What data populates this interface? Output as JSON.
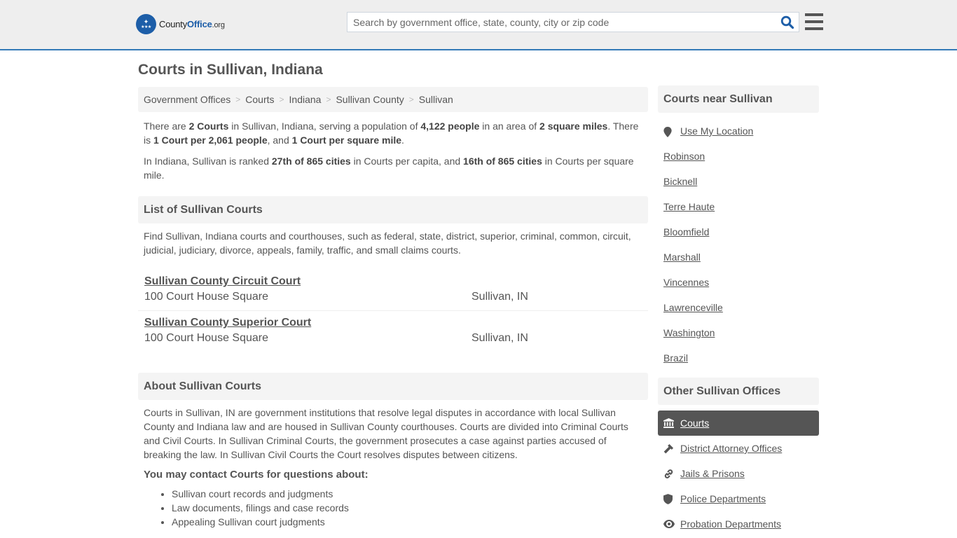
{
  "header": {
    "logo": {
      "prefix": "County",
      "brand": "Office",
      "suffix": ".org",
      "color": "#1d5ea8"
    },
    "search": {
      "placeholder": "Search by government office, state, county, city or zip code",
      "value": ""
    },
    "search_icon": "search-icon",
    "menu_icon": "hamburger-menu-icon",
    "accent": "#337ab7"
  },
  "page": {
    "title": "Courts in Sullivan, Indiana"
  },
  "breadcrumb": [
    "Government Offices",
    "Courts",
    "Indiana",
    "Sullivan County",
    "Sullivan"
  ],
  "summary": {
    "p1": {
      "t1": "There are ",
      "b1": "2 Courts",
      "t2": " in Sullivan, Indiana, serving a population of ",
      "b2": "4,122 people",
      "t3": " in an area of ",
      "b3": "2 square miles",
      "t4": ". There is ",
      "b4": "1 Court per 2,061 people",
      "t5": ", and ",
      "b5": "1 Court per square mile",
      "t6": "."
    },
    "p2": {
      "t1": "In Indiana, Sullivan is ranked ",
      "b1": "27th of 865 cities",
      "t2": " in Courts per capita, and ",
      "b2": "16th of 865 cities",
      "t3": " in Courts per square mile."
    }
  },
  "list_section": {
    "title": "List of Sullivan Courts",
    "description": "Find Sullivan, Indiana courts and courthouses, such as federal, state, district, superior, criminal, common, circuit, judicial, judiciary, divorce, appeals, family, traffic, and small claims courts.",
    "courts": [
      {
        "name": "Sullivan County Circuit Court",
        "address": "100 Court House Square",
        "city": "Sullivan, IN"
      },
      {
        "name": "Sullivan County Superior Court",
        "address": "100 Court House Square",
        "city": "Sullivan, IN"
      }
    ]
  },
  "about_section": {
    "title": "About Sullivan Courts",
    "text": "Courts in Sullivan, IN are government institutions that resolve legal disputes in accordance with local Sullivan County and Indiana law and are housed in Sullivan County courthouses. Courts are divided into Criminal Courts and Civil Courts. In Sullivan Criminal Courts, the government prosecutes a case against parties accused of breaking the law. In Sullivan Civil Courts the Court resolves disputes between citizens.",
    "contact_heading": "You may contact Courts for questions about:",
    "contact_items": [
      "Sullivan court records and judgments",
      "Law documents, filings and case records",
      "Appealing Sullivan court judgments"
    ]
  },
  "sidebar": {
    "near_title": "Courts near Sullivan",
    "use_location": {
      "label": "Use My Location",
      "icon": "map-marker-icon"
    },
    "near_cities": [
      "Robinson",
      "Bicknell",
      "Terre Haute",
      "Bloomfield",
      "Marshall",
      "Vincennes",
      "Lawrenceville",
      "Washington",
      "Brazil"
    ],
    "offices_title": "Other Sullivan Offices",
    "offices": [
      {
        "label": "Courts",
        "icon": "courthouse-icon",
        "active": true
      },
      {
        "label": "District Attorney Offices",
        "icon": "gavel-icon",
        "active": false
      },
      {
        "label": "Jails & Prisons",
        "icon": "link-icon",
        "active": false
      },
      {
        "label": "Police Departments",
        "icon": "shield-icon",
        "active": false
      },
      {
        "label": "Probation Departments",
        "icon": "eye-icon",
        "active": false
      }
    ]
  }
}
